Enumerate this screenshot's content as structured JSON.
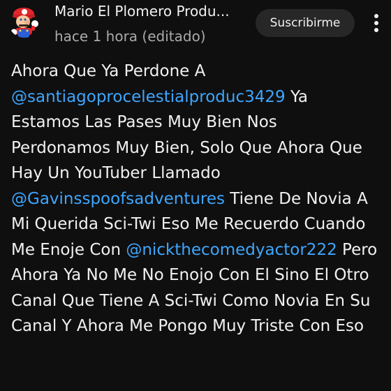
{
  "post": {
    "channel_name": "Mario El Plomero Produ...",
    "timestamp": "hace 1 hora (editado)",
    "subscribe_label": "Suscribirme",
    "more_icon": "vertical-dots-icon",
    "avatar_icon": "mario-avatar",
    "body": {
      "t1": "Ahora Que Ya Perdone A ",
      "m1": "@santiagoprocelestialproduc3429",
      "t2": "  Ya Estamos Las Pases Muy Bien Nos Perdonamos Muy Bien, Solo Que  Ahora Que Hay Un YouTuber Llamado ",
      "m2": "@Gavinsspoofsadventures",
      "t3": " Tiene De Novia A Mi Querida Sci-Twi Eso Me Recuerdo Cuando Me Enoje Con ",
      "m3": "@nickthecomedyactor222",
      "t4": " Pero Ahora Ya No Me No Enojo Con El Sino El Otro Canal Que Tiene A Sci-Twi Como Novia En Su Canal Y Ahora Me Pongo Muy Triste Con Eso"
    }
  },
  "colors": {
    "background": "#0f0f0f",
    "text": "#f1f1f1",
    "secondary_text": "#aaaaaa",
    "mention": "#3ea6ff",
    "button_bg": "#272727"
  }
}
